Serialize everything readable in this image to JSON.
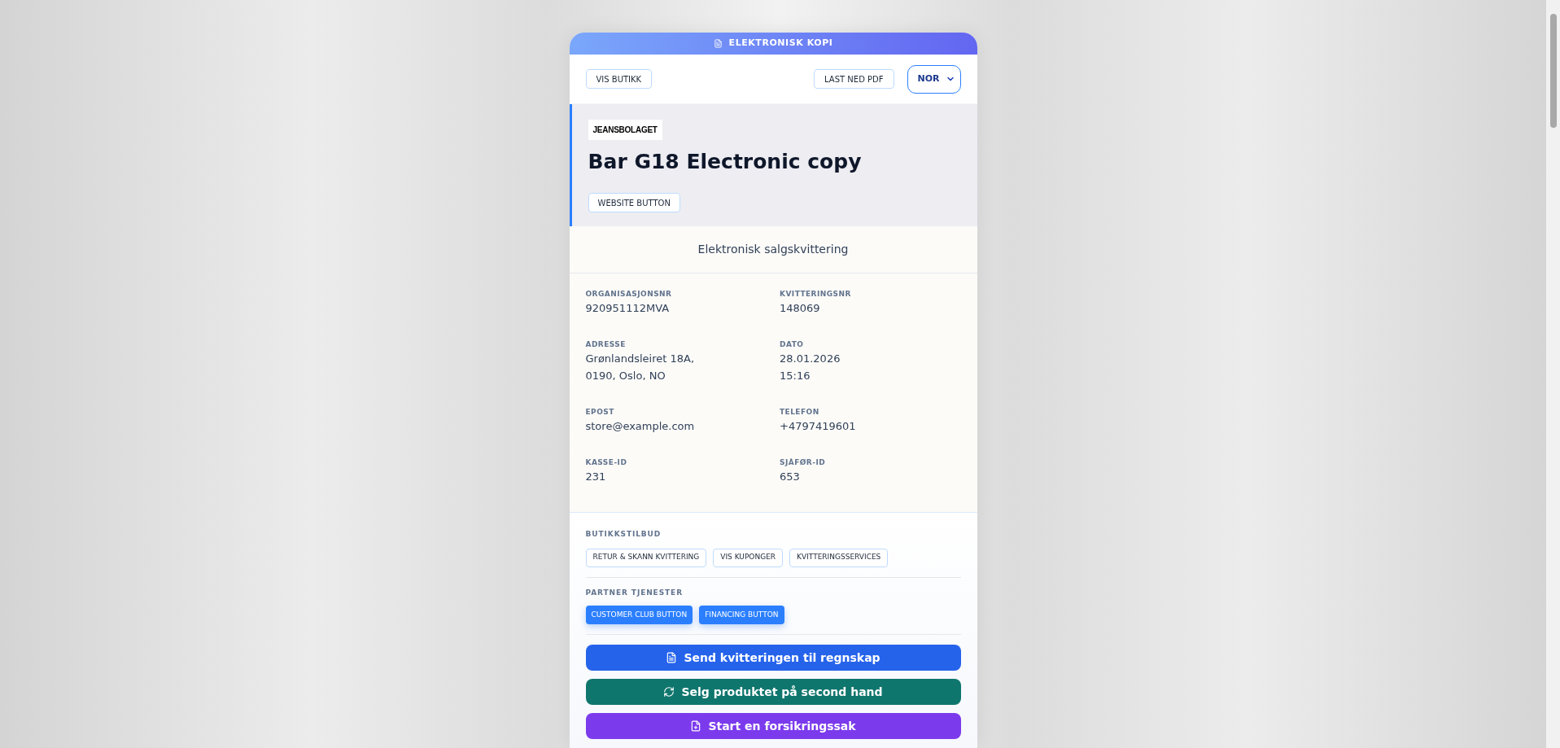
{
  "banner": {
    "title": "ELEKTRONISK KOPI"
  },
  "toolbar": {
    "store_button": "VIS BUTIKK",
    "pdf_button": "LAST NED PDF",
    "language": "NOR"
  },
  "header": {
    "logo": "JEANSBOLAGET",
    "title": "Bar G18 Electronic copy",
    "website_button": "WEBSITE BUTTON"
  },
  "receipt": {
    "subtitle": "Elektronisk salgskvittering",
    "fields": [
      {
        "label": "ORGANISASJONSNR",
        "lines": [
          "920951112MVA"
        ]
      },
      {
        "label": "KVITTERINGSNR",
        "lines": [
          "148069"
        ]
      },
      {
        "label": "ADRESSE",
        "lines": [
          "Grønlandsleiret 18A,",
          "0190, Oslo, NO"
        ]
      },
      {
        "label": "DATO",
        "lines": [
          "28.01.2026",
          "15:16"
        ]
      },
      {
        "label": "EPOST",
        "lines": [
          "store@example.com"
        ]
      },
      {
        "label": "TELEFON",
        "lines": [
          "+4797419601"
        ]
      },
      {
        "label": "KASSE-ID",
        "lines": [
          "231"
        ]
      },
      {
        "label": "SJÅFØR-ID",
        "lines": [
          "653"
        ]
      }
    ]
  },
  "store_offers": {
    "title": "BUTIKKSTILBUD",
    "buttons": [
      "RETUR & SKANN KVITTERING",
      "VIS KUPONGER",
      "KVITTERINGSSERVICES"
    ]
  },
  "partner_services": {
    "title": "PARTNER TJENESTER",
    "buttons": [
      "CUSTOMER CLUB BUTTON",
      "FINANCING BUTTON"
    ]
  },
  "actions": [
    {
      "label": "Send kvitteringen til regnskap",
      "kind": "document",
      "color": "#2563eb"
    },
    {
      "label": "Selg produktet på second hand",
      "kind": "recycle",
      "color": "#0f766e"
    },
    {
      "label": "Start en forsikringssak",
      "kind": "claim",
      "color": "#7c3aed"
    }
  ]
}
